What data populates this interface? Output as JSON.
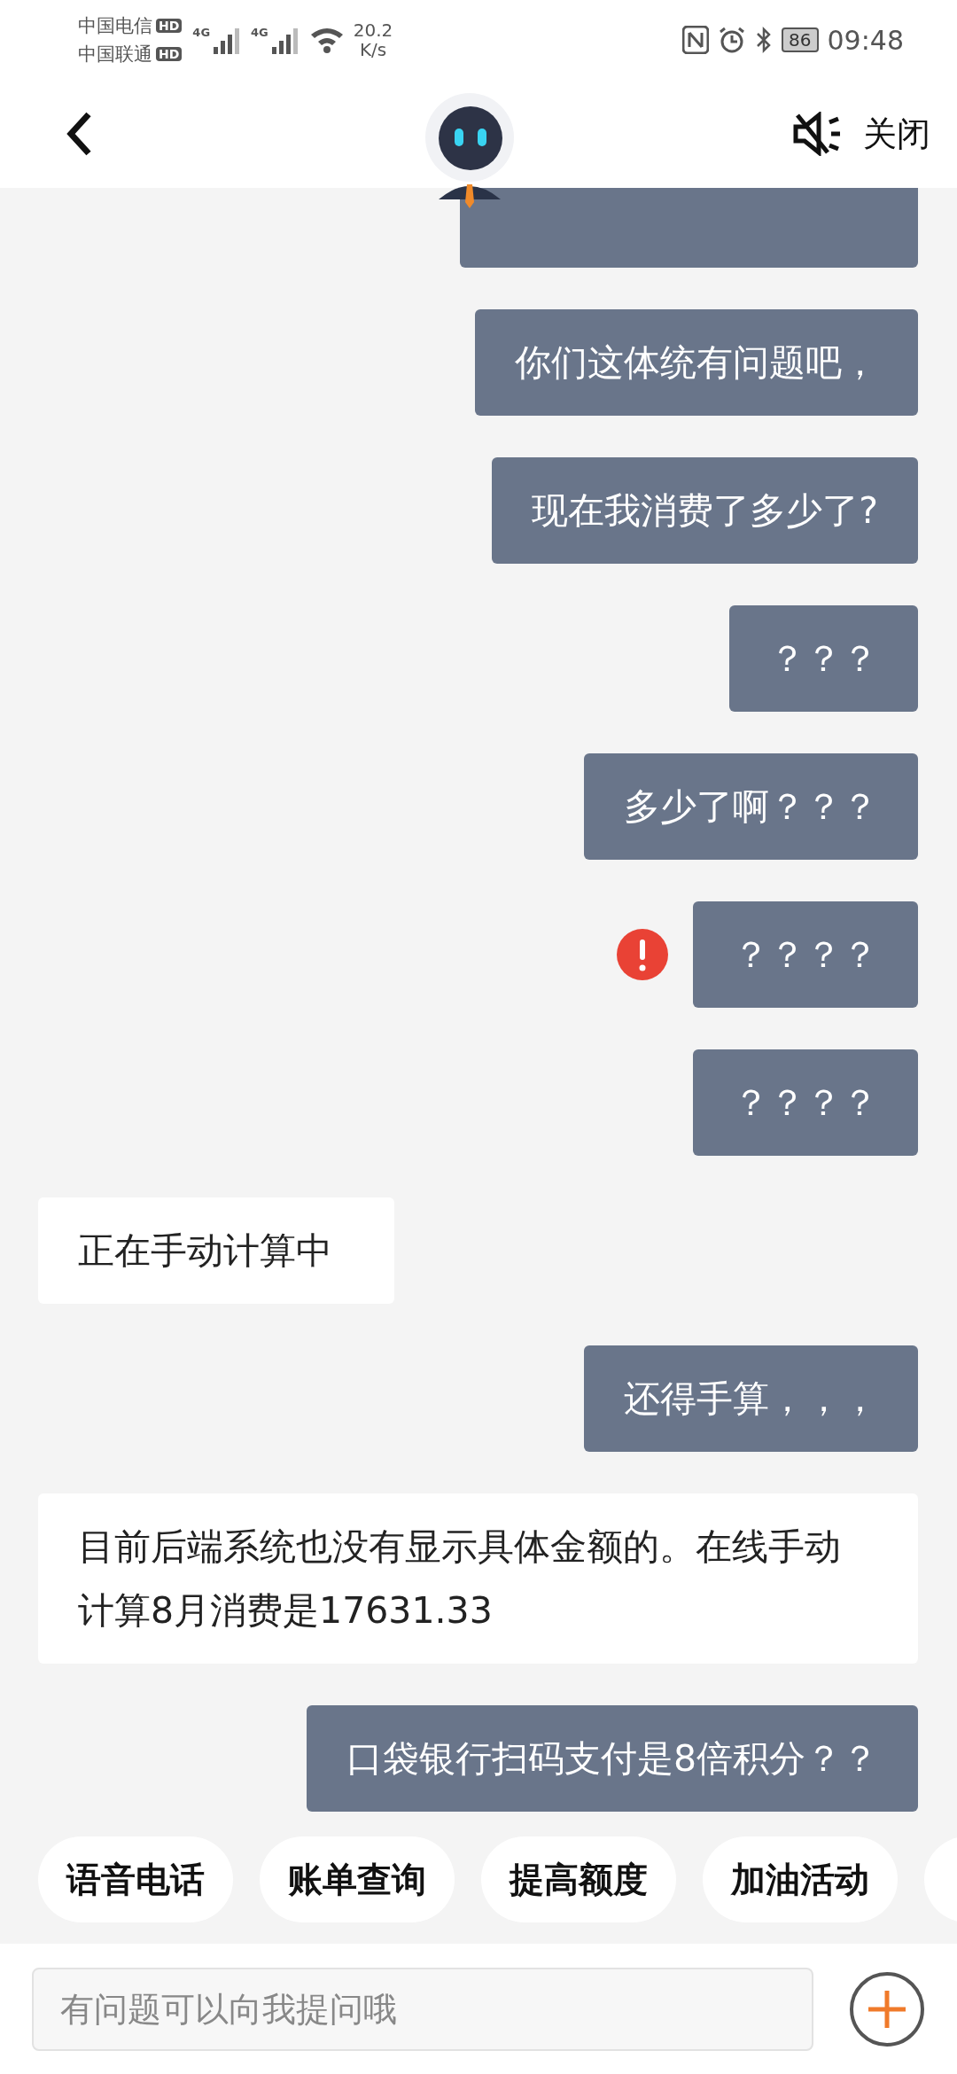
{
  "status_bar": {
    "carriers": [
      {
        "name": "中国电信",
        "badge": "HD"
      },
      {
        "name": "中国联通",
        "badge": "HD"
      }
    ],
    "network": [
      "4G",
      "4G"
    ],
    "speed_value": "20.2",
    "speed_unit": "K/s",
    "battery": "86",
    "time": "09:48"
  },
  "header": {
    "close_label": "关闭",
    "muted": true
  },
  "messages": [
    {
      "outgoing": true,
      "kind": "clipped"
    },
    {
      "outgoing": true,
      "kind": "text",
      "text": "你们这体统有问题吧，",
      "failed": false
    },
    {
      "outgoing": true,
      "kind": "text",
      "text": "现在我消费了多少了?",
      "failed": false
    },
    {
      "outgoing": true,
      "kind": "text",
      "text": "？？？",
      "failed": false
    },
    {
      "outgoing": true,
      "kind": "text",
      "text": "多少了啊？？？",
      "failed": false
    },
    {
      "outgoing": true,
      "kind": "text",
      "text": "？？？？",
      "failed": true
    },
    {
      "outgoing": true,
      "kind": "text",
      "text": "？？？？",
      "failed": false
    },
    {
      "outgoing": false,
      "kind": "text",
      "text": "正在手动计算中"
    },
    {
      "outgoing": true,
      "kind": "text",
      "text": "还得手算，，，",
      "failed": false
    },
    {
      "outgoing": false,
      "kind": "text",
      "text": "目前后端系统也没有显示具体金额的。在线手动计算8月消费是17631.33"
    },
    {
      "outgoing": true,
      "kind": "text",
      "text": "口袋银行扫码支付是8倍积分？？",
      "failed": false
    }
  ],
  "quick_replies": [
    {
      "label": "语音电话"
    },
    {
      "label": "账单查询"
    },
    {
      "label": "提高额度"
    },
    {
      "label": "加油活动"
    },
    {
      "kind": "clipped"
    }
  ],
  "input": {
    "placeholder": "有问题可以向我提问哦"
  }
}
